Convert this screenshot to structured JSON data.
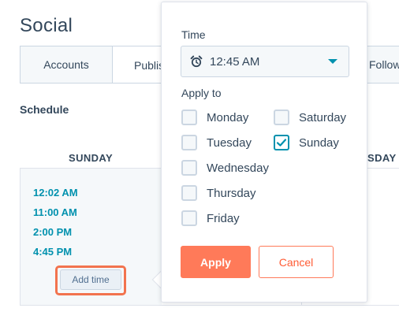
{
  "page": {
    "title": "Social"
  },
  "tabs": [
    {
      "label": "Accounts"
    },
    {
      "label": "Publis"
    },
    {
      "label": "Follow"
    }
  ],
  "schedule": {
    "label": "Schedule",
    "day_left": "SUNDAY",
    "day_right": "SDAY",
    "times": [
      "12:02 AM",
      "11:00 AM",
      "2:00 PM",
      "4:45 PM"
    ],
    "add_time_label": "Add time"
  },
  "popover": {
    "time_label": "Time",
    "time_value": "12:45 AM",
    "apply_to_label": "Apply to",
    "days": [
      {
        "label": "Monday",
        "checked": false
      },
      {
        "label": "Tuesday",
        "checked": false
      },
      {
        "label": "Wednesday",
        "checked": false
      },
      {
        "label": "Thursday",
        "checked": false
      },
      {
        "label": "Friday",
        "checked": false
      },
      {
        "label": "Saturday",
        "checked": false
      },
      {
        "label": "Sunday",
        "checked": true
      }
    ],
    "apply_label": "Apply",
    "cancel_label": "Cancel"
  },
  "colors": {
    "accent": "#ff7a59",
    "link": "#0091ae",
    "text": "#33475b",
    "highlight": "#f2734e"
  },
  "icons": {
    "time_select": "alarm-clock-icon",
    "dropdown": "caret-down-icon",
    "checkmark": "checkmark-icon"
  }
}
